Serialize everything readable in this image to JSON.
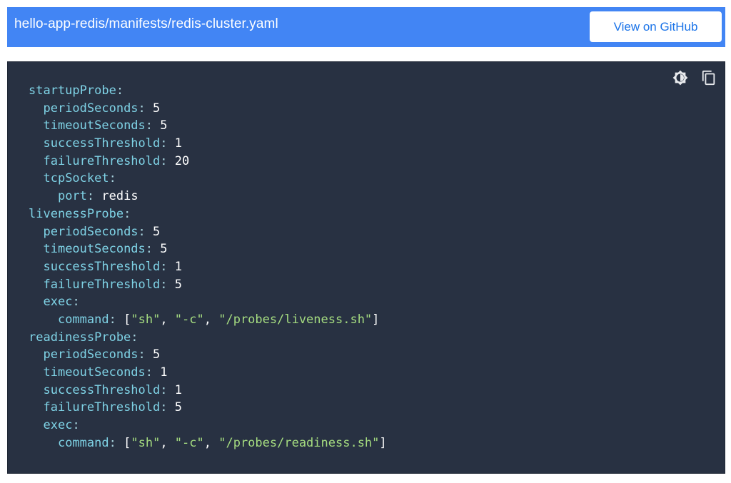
{
  "header": {
    "file_path": "hello-app-redis/manifests/redis-cluster.yaml",
    "github_button": "View on GitHub"
  },
  "toolbar": {
    "icons": [
      "theme-toggle-icon",
      "copy-icon"
    ]
  },
  "code": {
    "lines": [
      {
        "indent": "",
        "key": "startupProbe",
        "value": ""
      },
      {
        "indent": "  ",
        "key": "periodSeconds",
        "value": "5"
      },
      {
        "indent": "  ",
        "key": "timeoutSeconds",
        "value": "5"
      },
      {
        "indent": "  ",
        "key": "successThreshold",
        "value": "1"
      },
      {
        "indent": "  ",
        "key": "failureThreshold",
        "value": "20"
      },
      {
        "indent": "  ",
        "key": "tcpSocket",
        "value": ""
      },
      {
        "indent": "    ",
        "key": "port",
        "value": "redis"
      },
      {
        "indent": "",
        "key": "livenessProbe",
        "value": ""
      },
      {
        "indent": "  ",
        "key": "periodSeconds",
        "value": "5"
      },
      {
        "indent": "  ",
        "key": "timeoutSeconds",
        "value": "5"
      },
      {
        "indent": "  ",
        "key": "successThreshold",
        "value": "1"
      },
      {
        "indent": "  ",
        "key": "failureThreshold",
        "value": "5"
      },
      {
        "indent": "  ",
        "key": "exec",
        "value": ""
      },
      {
        "indent": "    ",
        "key": "command",
        "array": [
          "\"sh\"",
          "\"-c\"",
          "\"/probes/liveness.sh\""
        ]
      },
      {
        "indent": "",
        "key": "readinessProbe",
        "value": ""
      },
      {
        "indent": "  ",
        "key": "periodSeconds",
        "value": "5"
      },
      {
        "indent": "  ",
        "key": "timeoutSeconds",
        "value": "1"
      },
      {
        "indent": "  ",
        "key": "successThreshold",
        "value": "1"
      },
      {
        "indent": "  ",
        "key": "failureThreshold",
        "value": "5"
      },
      {
        "indent": "  ",
        "key": "exec",
        "value": ""
      },
      {
        "indent": "    ",
        "key": "command",
        "array": [
          "\"sh\"",
          "\"-c\"",
          "\"/probes/readiness.sh\""
        ]
      }
    ]
  },
  "colors": {
    "header_bg": "#4285f4",
    "button_text": "#1a73e8",
    "code_bg": "#283142",
    "key": "#7fd3e6",
    "string": "#a5dc80",
    "value": "#ffffff"
  }
}
